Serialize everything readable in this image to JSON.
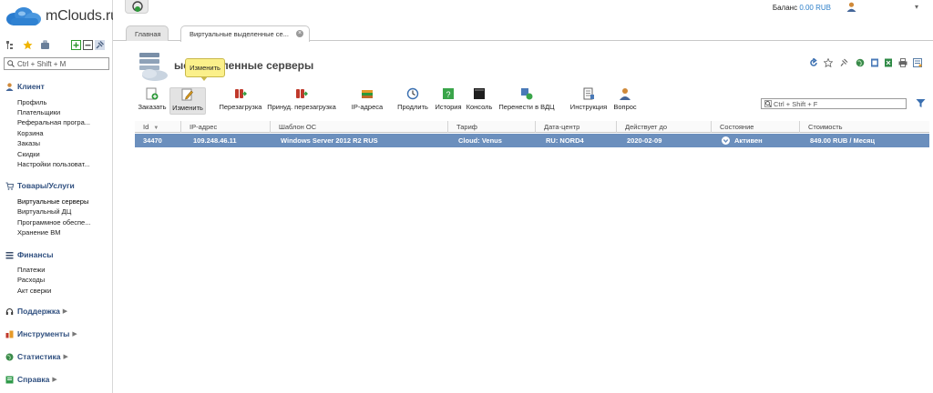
{
  "app": {
    "name": "mClouds.ru"
  },
  "topbar": {
    "balance_label": "Баланс",
    "balance_amount": "0.00 RUB"
  },
  "tabs": [
    {
      "label": "Главная"
    },
    {
      "label": "Виртуальные выделенные се..."
    }
  ],
  "sidebar": {
    "search_placeholder": "Ctrl + Shift + M",
    "sections": {
      "client": {
        "title": "Клиент",
        "items": [
          "Профиль",
          "Плательщики",
          "Реферальная програ...",
          "Корзина",
          "Заказы",
          "Скидки",
          "Настройки пользоват..."
        ]
      },
      "goods": {
        "title": "Товары/Услуги",
        "items": [
          "Виртуальные серверы",
          "Виртуальный ДЦ",
          "Программное обеспе...",
          "Хранение ВМ"
        ]
      },
      "finance": {
        "title": "Финансы",
        "items": [
          "Платежи",
          "Расходы",
          "Акт сверки"
        ]
      },
      "support": {
        "title": "Поддержка"
      },
      "tools": {
        "title": "Инструменты"
      },
      "stats": {
        "title": "Статистика"
      },
      "help": {
        "title": "Справка"
      }
    }
  },
  "page": {
    "title": "Виртуальные выделенные серверы",
    "title_visible": "ые выделенные серверы"
  },
  "tooltip": "Изменить",
  "toolbar": {
    "order": "Заказать",
    "edit": "Изменить",
    "reboot": "Перезагрузка",
    "force_reboot": "Принуд. перезагрузка",
    "ip": "IP-адреса",
    "prolong": "Продлить",
    "history": "История",
    "console": "Консоль",
    "move_vdc": "Перенести в ВДЦ",
    "instruction": "Инструкция",
    "question": "Вопрос"
  },
  "filter_placeholder": "Ctrl + Shift + F",
  "table": {
    "columns": [
      "Id",
      "IP-адрес",
      "Шаблон ОС",
      "Тариф",
      "Дата-центр",
      "Действует до",
      "Состояние",
      "Стоимость"
    ],
    "rows": [
      {
        "id": "34470",
        "ip": "109.248.46.11",
        "os": "Windows Server 2012 R2 RUS",
        "tariff": "Cloud: Venus",
        "dc": "RU: NORD4",
        "until": "2020-02-09",
        "status": "Активен",
        "cost": "849.00 RUB / Месяц"
      }
    ]
  },
  "colors": {
    "accent": "#2d7fc9",
    "selected_row": "#6b8fbd",
    "section_title": "#2f4f7f",
    "tooltip": "#fbf08a"
  }
}
